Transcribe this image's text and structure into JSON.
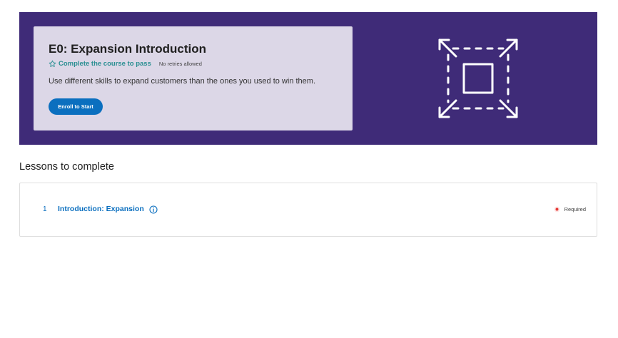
{
  "course": {
    "title": "E0: Expansion Introduction",
    "pass_requirement": "Complete the course to pass",
    "retries": "No retries allowed",
    "description": "Use different skills to expand customers than the ones you used to win them.",
    "enroll_label": "Enroll to Start",
    "hero_icon": "expand-arrows-icon"
  },
  "lessons": {
    "heading": "Lessons to complete",
    "items": [
      {
        "number": "1",
        "title": "Introduction: Expansion",
        "status": "Required"
      }
    ]
  },
  "colors": {
    "hero_background": "#3f2b78",
    "card_background": "#dcd7e7",
    "accent_teal": "#2a8f92",
    "primary_blue": "#0b6fbf",
    "required_red": "#e53935"
  }
}
